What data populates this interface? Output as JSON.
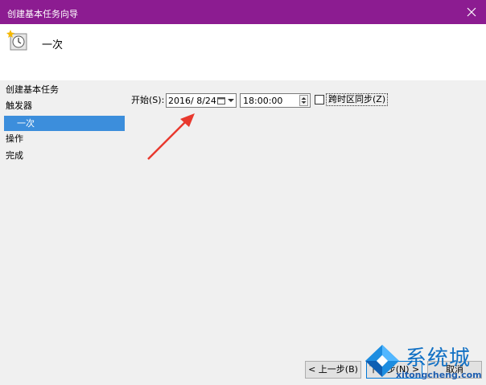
{
  "window": {
    "title": "创建基本任务向导",
    "header_title": "一次"
  },
  "nav": {
    "items": [
      {
        "label": "创建基本任务"
      },
      {
        "label": "触发器"
      },
      {
        "label": "一次"
      },
      {
        "label": "操作"
      },
      {
        "label": "完成"
      }
    ]
  },
  "form": {
    "start_label": "开始(S):",
    "date_value": "2016/  8/24",
    "time_value": "18:00:00",
    "sync_label": "跨时区同步(Z)",
    "sync_checked": false
  },
  "buttons": {
    "back": "< 上一步(B)",
    "next": "下一步(N) >",
    "cancel": "取消"
  },
  "watermark": {
    "brand": "系统城",
    "url": "xitongcheng.com"
  },
  "colors": {
    "titlebar": "#8c1c91",
    "nav_active": "#3c8edc",
    "arrow": "#e8392e",
    "watermark": "#1170c4"
  }
}
